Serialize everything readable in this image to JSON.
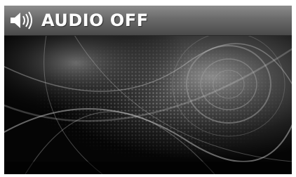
{
  "header": {
    "title": "AUDIO OFF",
    "icon": "speaker-icon"
  },
  "background": {
    "description_icon": "abstract-speaker-wallpaper"
  }
}
